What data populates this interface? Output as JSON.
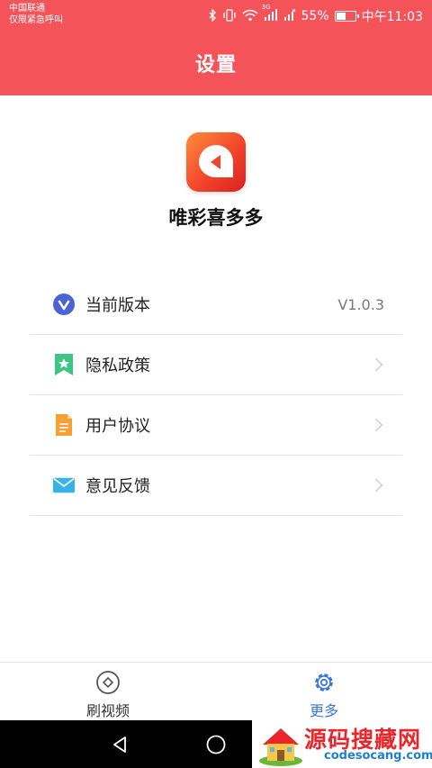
{
  "status_bar": {
    "carrier_line1": "中国联通",
    "carrier_line2": "仅限紧急呼叫",
    "network_label": "3G",
    "battery_text": "55%",
    "battery_level": 0.55,
    "time": "中午11:03",
    "icons": [
      "bluetooth-icon",
      "vibrate-icon",
      "wifi-icon",
      "signal-icon",
      "no-signal-icon",
      "battery-icon"
    ]
  },
  "header": {
    "title": "设置"
  },
  "app": {
    "name": "唯彩喜多多",
    "logo_icon": "play-logo-icon"
  },
  "settings": [
    {
      "icon": "version-v-icon",
      "label": "当前版本",
      "value": "V1.0.3",
      "has_chevron": false
    },
    {
      "icon": "bookmark-star-icon",
      "label": "隐私政策",
      "value": "",
      "has_chevron": true
    },
    {
      "icon": "document-icon",
      "label": "用户协议",
      "value": "",
      "has_chevron": true
    },
    {
      "icon": "mail-icon",
      "label": "意见反馈",
      "value": "",
      "has_chevron": true
    }
  ],
  "tabs": [
    {
      "label": "刷视频",
      "icon": "video-compass-icon",
      "active": false
    },
    {
      "label": "更多",
      "icon": "gear-icon",
      "active": true
    }
  ],
  "colors": {
    "brand_red": "#f4535a",
    "tab_active": "#3a78d8",
    "tab_inactive": "#333333",
    "watermark_red": "#e8262b",
    "watermark_blue": "#1f7fc7"
  },
  "watermark": {
    "title": "源码搜藏网",
    "url": "codesocang.com"
  }
}
